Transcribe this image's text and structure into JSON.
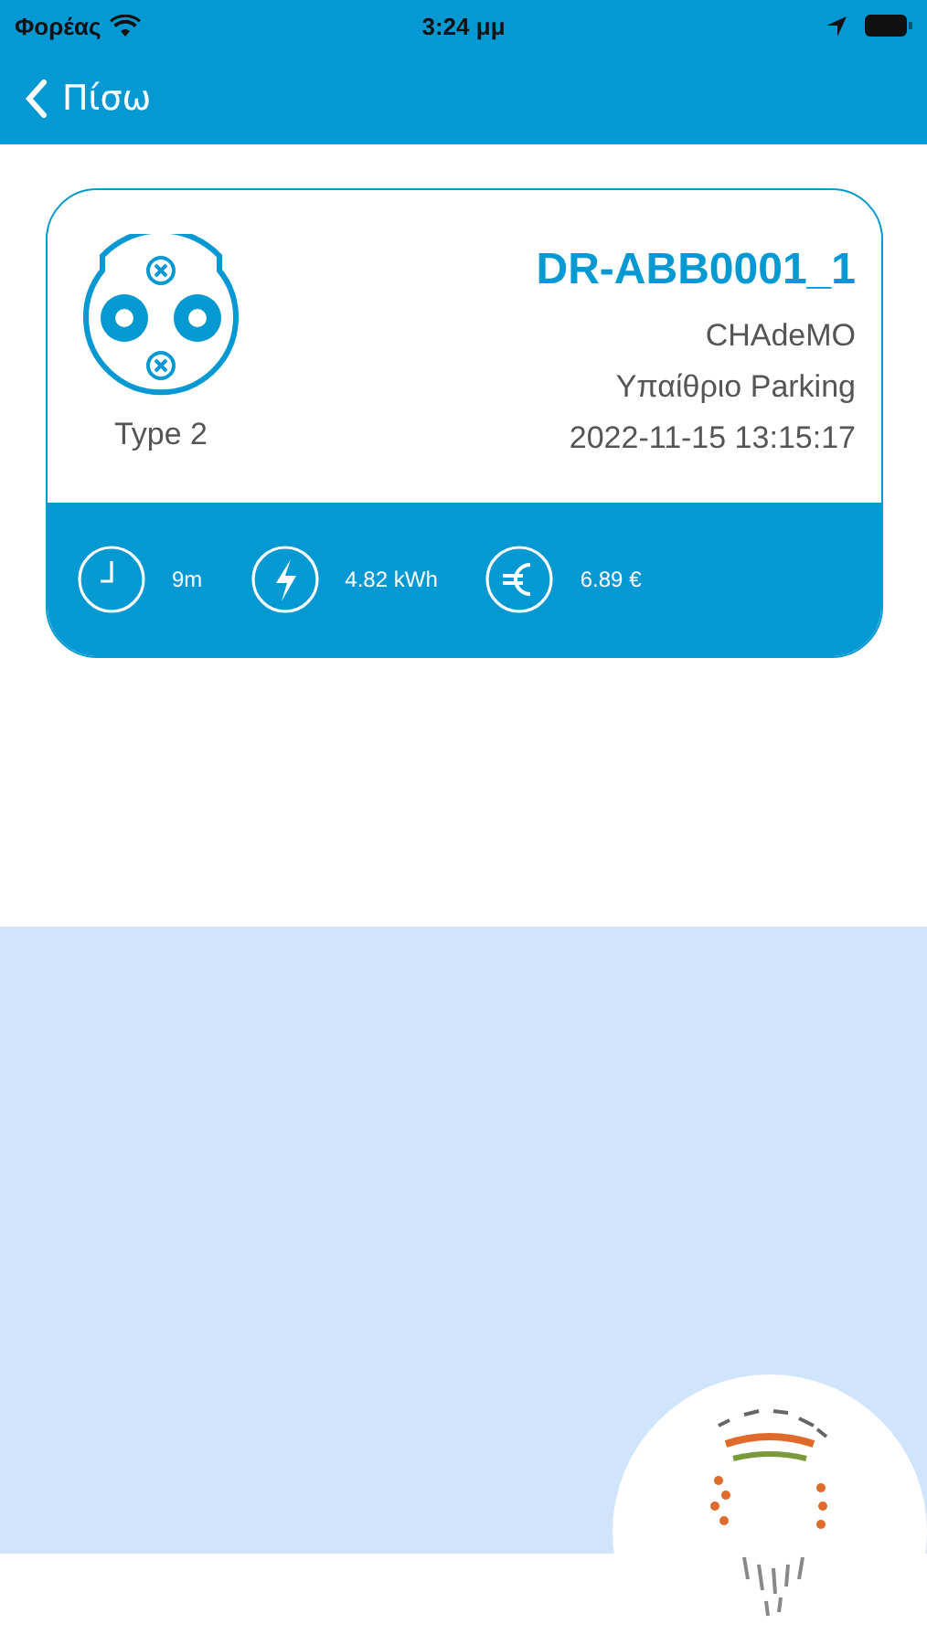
{
  "status_bar": {
    "carrier": "Φορέας",
    "time": "3:24 μμ"
  },
  "nav": {
    "back": "Πίσω"
  },
  "session": {
    "connector": "Type 2",
    "station": "DR-ABB0001_1",
    "plug": "CHAdeMO",
    "location": "Υπαίθριο Parking",
    "datetime": "2022-11-15 13:15:17",
    "stats": [
      {
        "kind": "duration",
        "value": "9m"
      },
      {
        "kind": "energy",
        "value": "4.82 kWh"
      },
      {
        "kind": "cost",
        "value": "6.89 €"
      }
    ]
  }
}
